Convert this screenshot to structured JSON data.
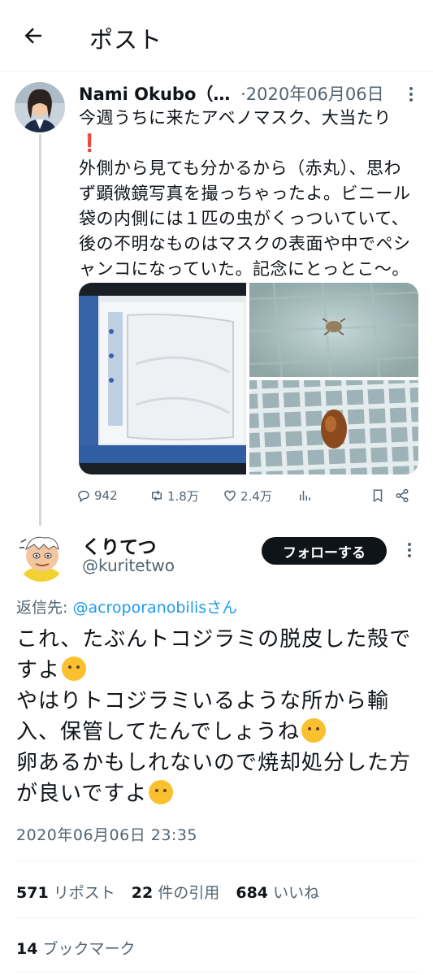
{
  "header": {
    "title": "ポスト"
  },
  "quoted_tweet": {
    "author_name": "Nami Okubo（…",
    "separator": "·",
    "date": "2020年06月06日",
    "text_lines": [
      "今週うちに来たアベノマスク、大当たり",
      "❗",
      "外側から見ても分かるから（赤丸）、思わ",
      "ず顕微鏡写真を撮っちゃったよ。ビニール",
      "袋の内側には１匹の虫がくっついていて、",
      "後の不明なものはマスクの表面や中でペシ",
      "ャンコになっていた。記念にとっとこ〜。"
    ],
    "stats": {
      "replies": "942",
      "reposts": "1.8万",
      "likes": "2.4万"
    }
  },
  "reply_tweet": {
    "author_name": "くりてつ",
    "handle": "@kuritetwo",
    "follow_label": "フォローする",
    "reply_prefix": "返信先: ",
    "reply_mention": "@acroporanobilisさん",
    "text_lines": [
      "これ、たぶんトコジラミの脱皮した殻で",
      "すよ",
      "やはりトコジラミいるような所から輸",
      "入、保管してたんでしょうね",
      "卵あるかもしれないので焼却処分した方",
      "が良いですよ"
    ],
    "timestamp": "2020年06月06日 23:35",
    "reposts_count": "571",
    "reposts_label": "リポスト",
    "quotes_count": "22",
    "quotes_label": "件の引用",
    "likes_count": "684",
    "likes_label": "いいね",
    "bookmarks_count": "14",
    "bookmarks_label": "ブックマーク"
  },
  "colors": {
    "accent": "#1d9bf0",
    "text": "#0f1419",
    "secondary": "#536471",
    "alert": "#e0245e"
  },
  "icons": [
    "back-arrow-icon",
    "more-icon",
    "reply-icon",
    "repost-icon",
    "like-icon",
    "views-icon",
    "bookmark-icon",
    "share-icon"
  ]
}
